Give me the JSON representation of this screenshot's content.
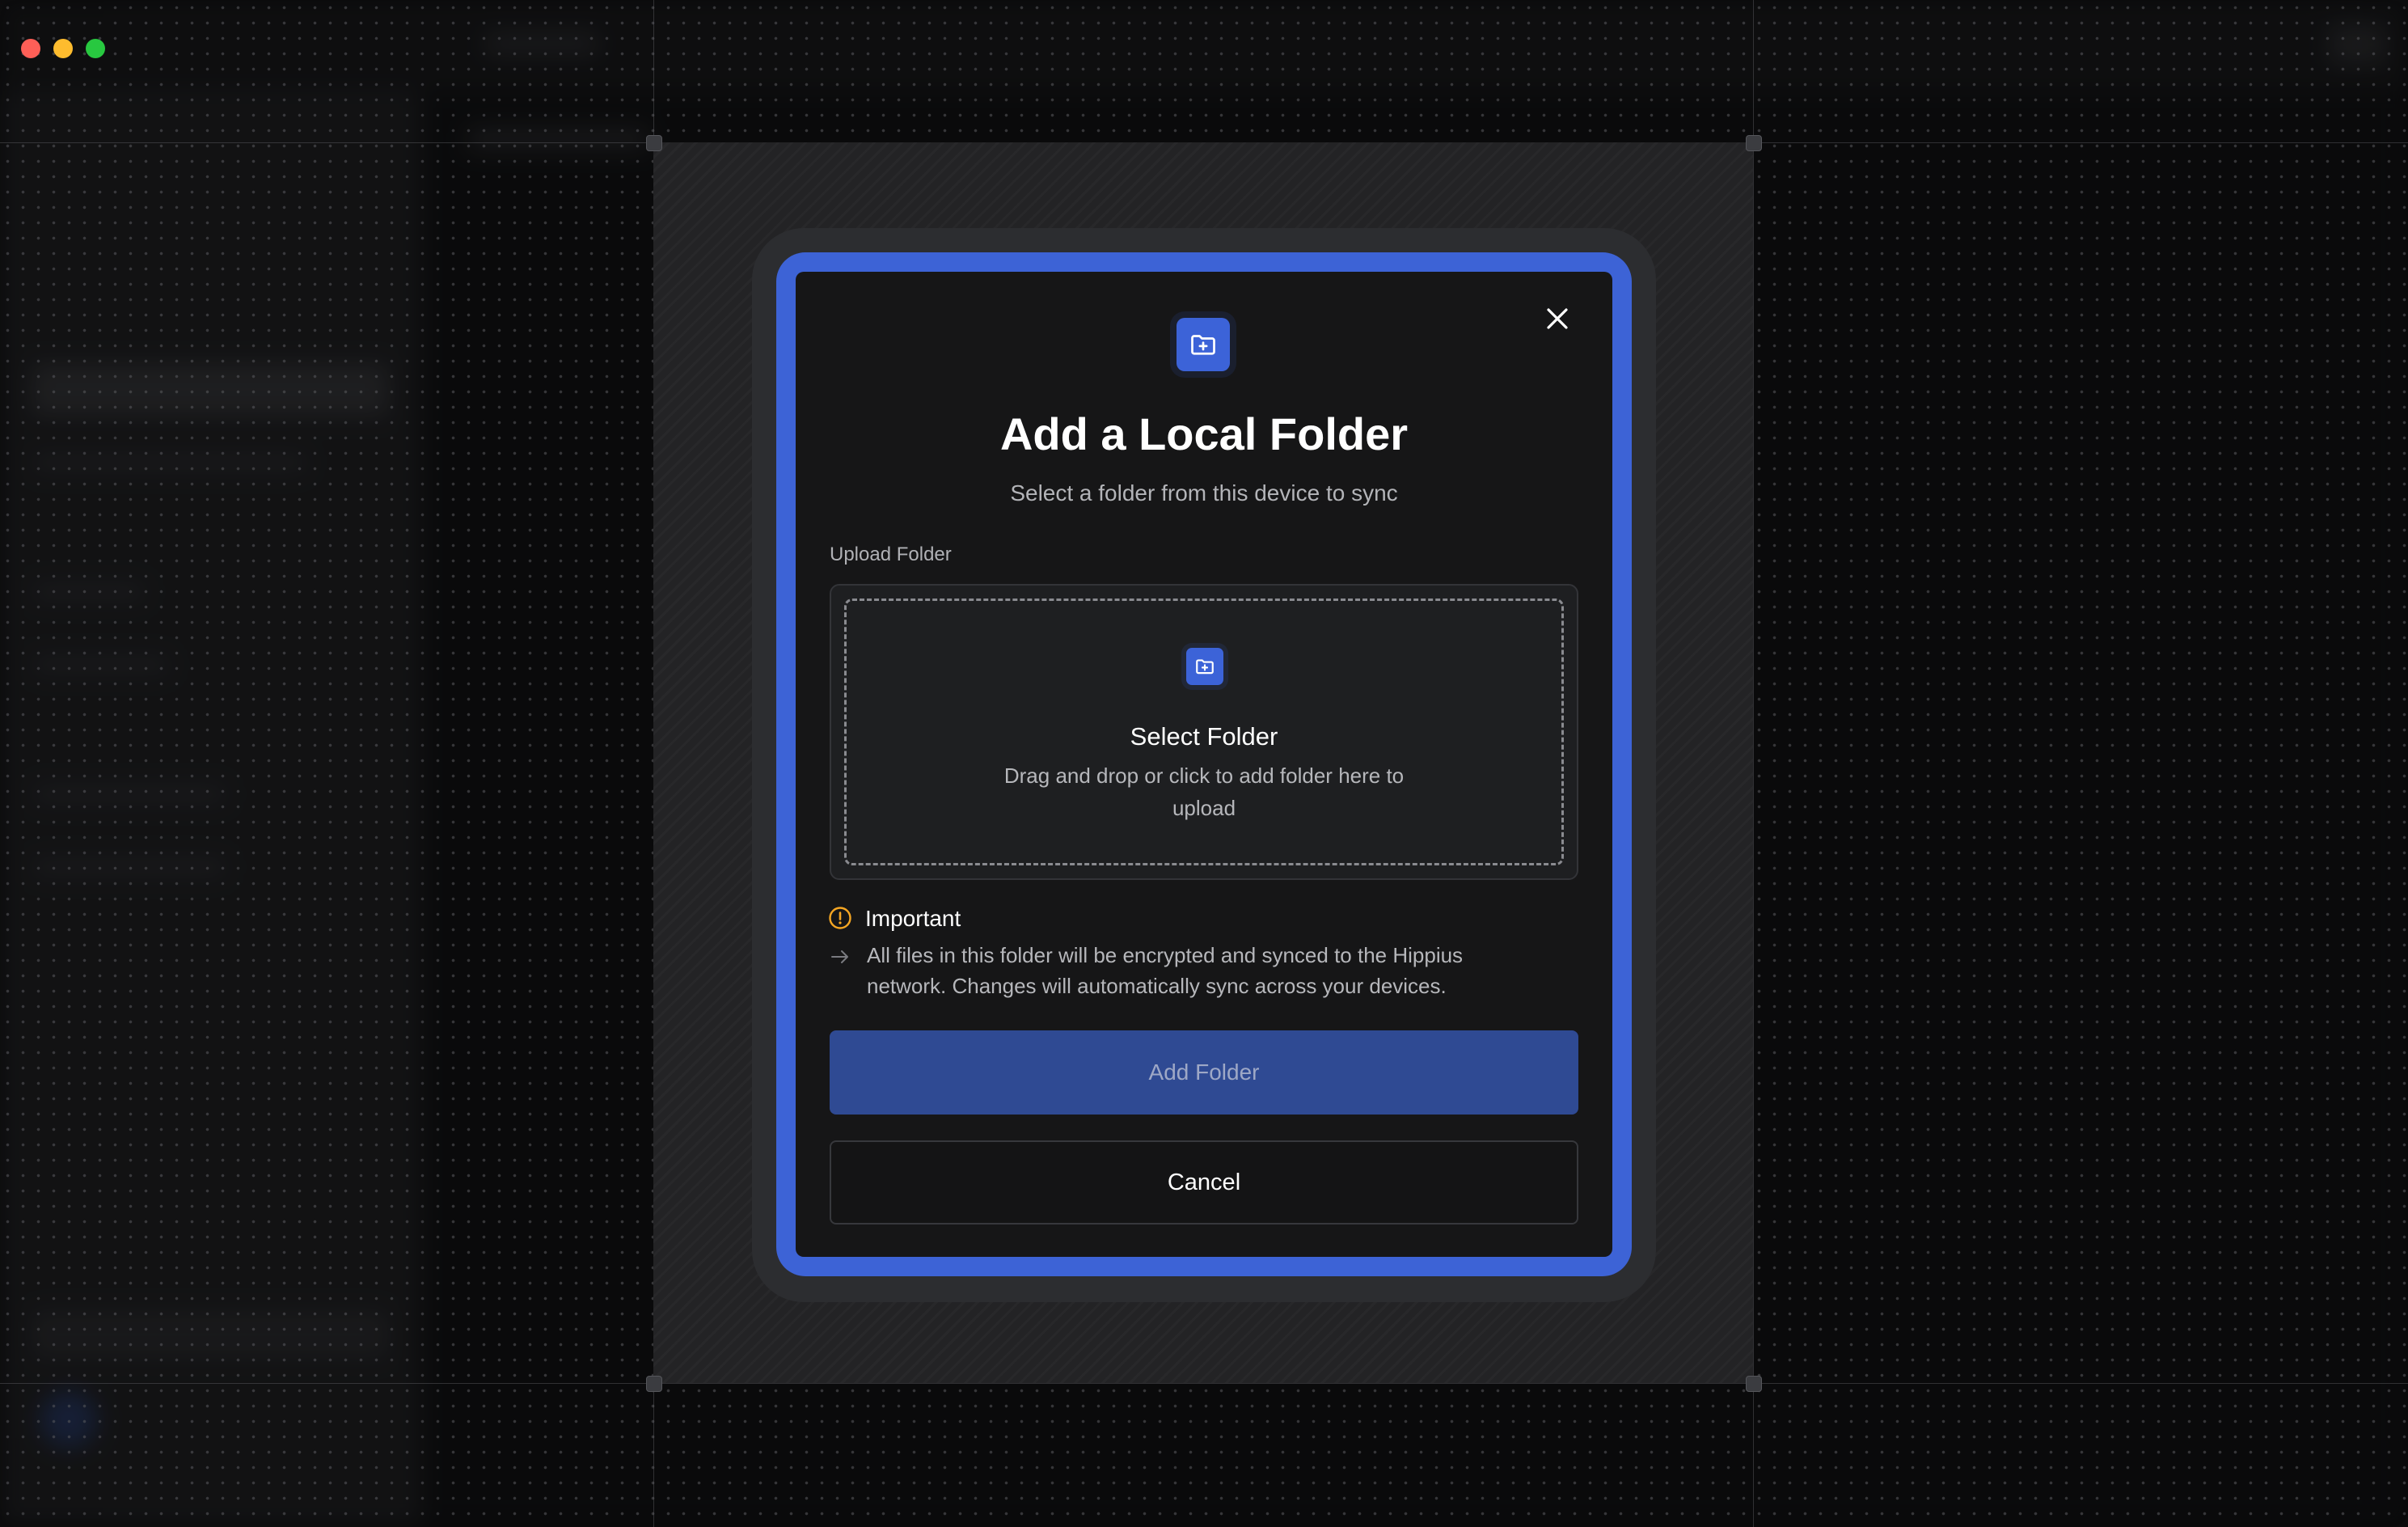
{
  "window": {
    "traffic_lights": [
      "close",
      "minimize",
      "zoom"
    ]
  },
  "modal": {
    "title": "Add a Local Folder",
    "subtitle": "Select a folder from this device to sync",
    "header_icon": "folder-plus-icon",
    "close_icon": "close-icon",
    "upload": {
      "label": "Upload Folder",
      "icon": "folder-plus-icon",
      "title": "Select Folder",
      "description": "Drag and drop or click to add folder here to upload"
    },
    "notice": {
      "icon": "alert-circle-icon",
      "title": "Important",
      "bullet_icon": "arrow-right-icon",
      "text": "All files in this folder will be encrypted and synced to the Hippius network. Changes will automatically sync across your devices."
    },
    "buttons": {
      "primary": "Add Folder",
      "secondary": "Cancel"
    }
  },
  "colors": {
    "accent": "#3d63d6",
    "primary_button": "#2f4a93",
    "warning": "#f5a623",
    "modal_background": "#161617"
  }
}
